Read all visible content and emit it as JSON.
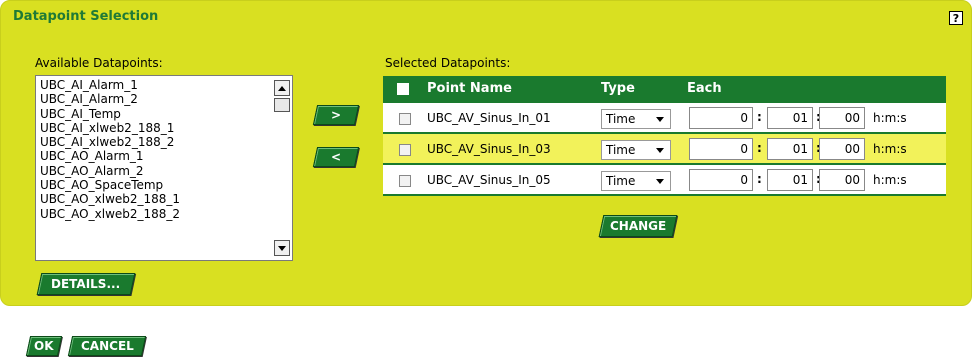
{
  "panel": {
    "title": "Datapoint Selection",
    "help_label": "?"
  },
  "available": {
    "label": "Available Datapoints:",
    "items": [
      "UBC_AI_Alarm_1",
      "UBC_AI_Alarm_2",
      "UBC_AI_Temp",
      "UBC_AI_xlweb2_188_1",
      "UBC_AI_xlweb2_188_2",
      "UBC_AO_Alarm_1",
      "UBC_AO_Alarm_2",
      "UBC_AO_SpaceTemp",
      "UBC_AO_xlweb2_188_1",
      "UBC_AO_xlweb2_188_2"
    ],
    "details_label": "DETAILS..."
  },
  "transfer": {
    "add_label": ">",
    "remove_label": "<"
  },
  "selected": {
    "label": "Selected Datapoints:",
    "headers": {
      "name": "Point Name",
      "type": "Type",
      "each": "Each"
    },
    "rows": [
      {
        "name": "UBC_AV_Sinus_In_01",
        "type": "Time",
        "h": "0",
        "m": "01",
        "s": "00",
        "unit": "h:m:s"
      },
      {
        "name": "UBC_AV_Sinus_In_03",
        "type": "Time",
        "h": "0",
        "m": "01",
        "s": "00",
        "unit": "h:m:s"
      },
      {
        "name": "UBC_AV_Sinus_In_05",
        "type": "Time",
        "h": "0",
        "m": "01",
        "s": "00",
        "unit": "h:m:s"
      }
    ],
    "change_label": "CHANGE"
  },
  "footer": {
    "ok_label": "OK",
    "cancel_label": "CANCEL"
  },
  "colors": {
    "panel": "#d9e021",
    "accent": "#1a7a2e",
    "highlight_row": "#f2f25a"
  }
}
